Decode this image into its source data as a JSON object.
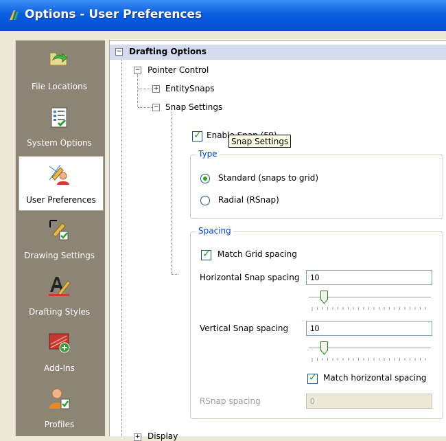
{
  "window": {
    "title": "Options - User Preferences"
  },
  "sidebar": {
    "items": [
      {
        "label": "File Locations",
        "icon": "folder-arrow-icon",
        "selected": false
      },
      {
        "label": "System Options",
        "icon": "checklist-icon",
        "selected": false
      },
      {
        "label": "User Preferences",
        "icon": "user-pencil-icon",
        "selected": true
      },
      {
        "label": "Drawing Settings",
        "icon": "pencil-check-icon",
        "selected": false
      },
      {
        "label": "Drafting Styles",
        "icon": "letter-a-pen-icon",
        "selected": false
      },
      {
        "label": "Add-Ins",
        "icon": "add-in-icon",
        "selected": false
      },
      {
        "label": "Profiles",
        "icon": "profile-icon",
        "selected": false
      }
    ]
  },
  "tree": {
    "section_title": "Drafting Options",
    "pointer_control": "Pointer Control",
    "entity_snaps": "EntitySnaps",
    "snap_settings": "Snap Settings",
    "display": "Display"
  },
  "snap": {
    "enable_label": "Enable Snap (F9)",
    "enable_checked": true,
    "tooltip": "Snap Settings",
    "type_group": "Type",
    "standard_label": "Standard (snaps to grid)",
    "radial_label": "Radial (RSnap)",
    "selected_type": "standard",
    "spacing_group": "Spacing",
    "match_grid_label": "Match Grid spacing",
    "match_grid_checked": true,
    "horizontal_label": "Horizontal Snap spacing",
    "horizontal_value": "10",
    "vertical_label": "Vertical Snap spacing",
    "vertical_value": "10",
    "match_horizontal_label": "Match horizontal spacing",
    "match_horizontal_checked": true,
    "rsnap_label": "RSnap spacing",
    "rsnap_value": "0",
    "horizontal_slider_fraction": 0.1,
    "vertical_slider_fraction": 0.1
  },
  "colors": {
    "title_bar": "#0553d6",
    "section_header": "#d4daf0",
    "sidebar": "#8c8474",
    "group_title": "#0046d5",
    "check": "#21a121"
  }
}
